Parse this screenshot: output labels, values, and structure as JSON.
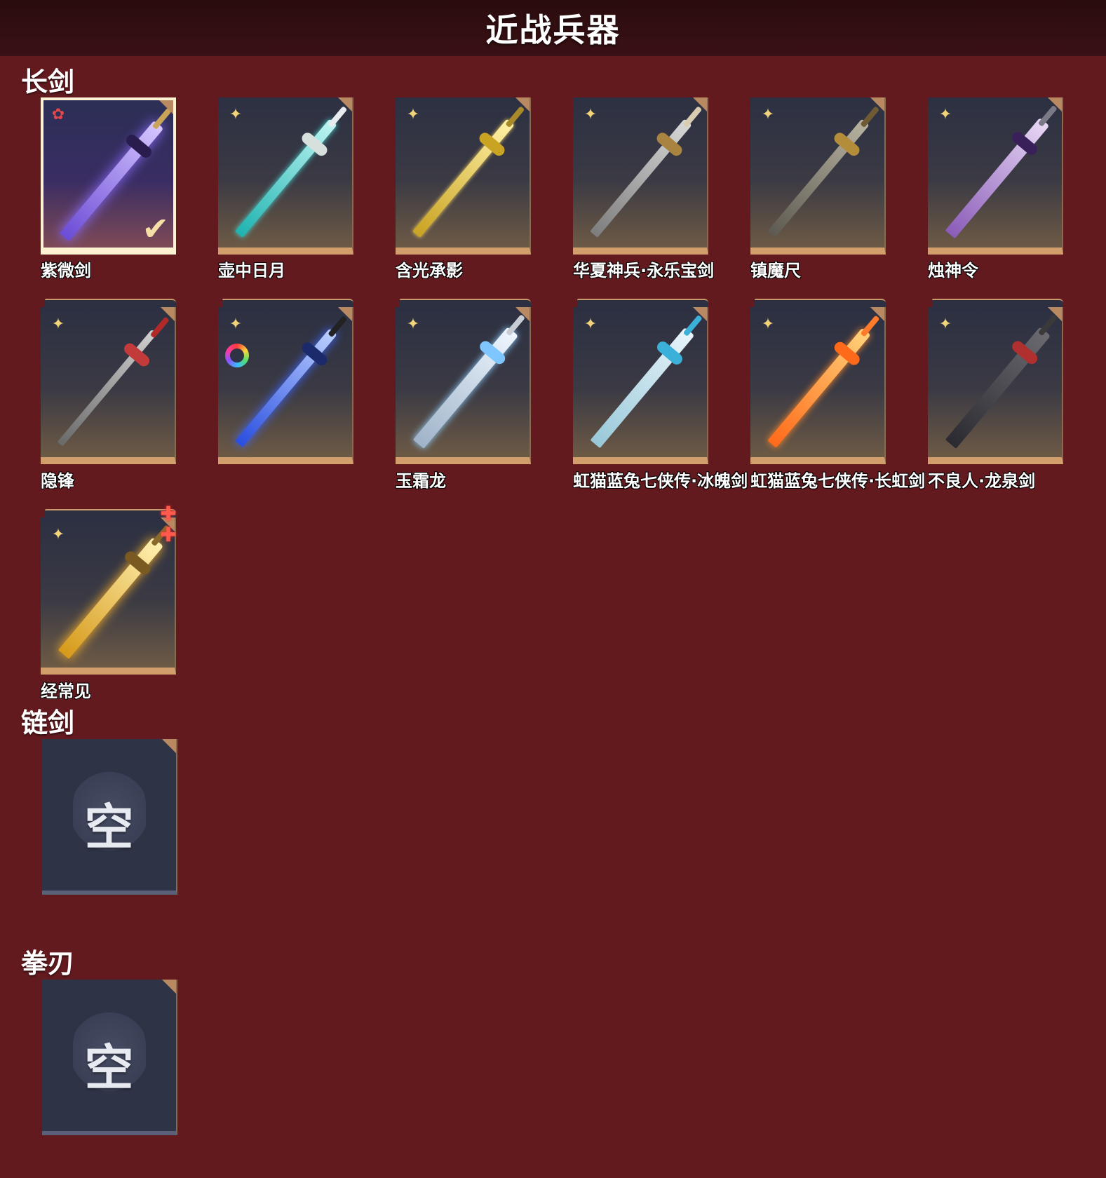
{
  "header": {
    "title": "近战兵器"
  },
  "sections": [
    {
      "title": "长剑",
      "items": [
        {
          "name": "紫微剑",
          "quality": "red-flower",
          "equipped": true
        },
        {
          "name": "壶中日月",
          "quality": "gold-shuriken"
        },
        {
          "name": "含光承影",
          "quality": "gold-shuriken"
        },
        {
          "name": "华夏神兵·永乐宝剑",
          "quality": "gold-shuriken"
        },
        {
          "name": "镇魔尺",
          "quality": "gold-shuriken"
        },
        {
          "name": "烛神令",
          "quality": "gold-shuriken"
        },
        {
          "name": "隐锋",
          "quality": "gold-shuriken"
        },
        {
          "name": "",
          "quality": "gold-shuriken",
          "badge": "rainbow-ring-icon"
        },
        {
          "name": "玉霜龙",
          "quality": "gold-shuriken"
        },
        {
          "name": "虹猫蓝兔七侠传·冰魄剑",
          "quality": "gold-shuriken"
        },
        {
          "name": "虹猫蓝兔七侠传·长虹剑",
          "quality": "gold-shuriken"
        },
        {
          "name": "不良人·龙泉剑",
          "quality": "gold-shuriken"
        },
        {
          "name": "经常见",
          "quality": "gold-shuriken",
          "badge": "red-plus-icon"
        }
      ]
    },
    {
      "title": "链剑",
      "empty_label": "空"
    },
    {
      "title": "拳刃",
      "empty_label": "空"
    }
  ],
  "colors": {
    "background": "#621a1f",
    "header_bg": "#2a0c0e",
    "card_accent": "#d29f6c",
    "selected_border": "#fff2d2",
    "quality_gold": "#f2d37a",
    "quality_red": "#e2474b"
  }
}
